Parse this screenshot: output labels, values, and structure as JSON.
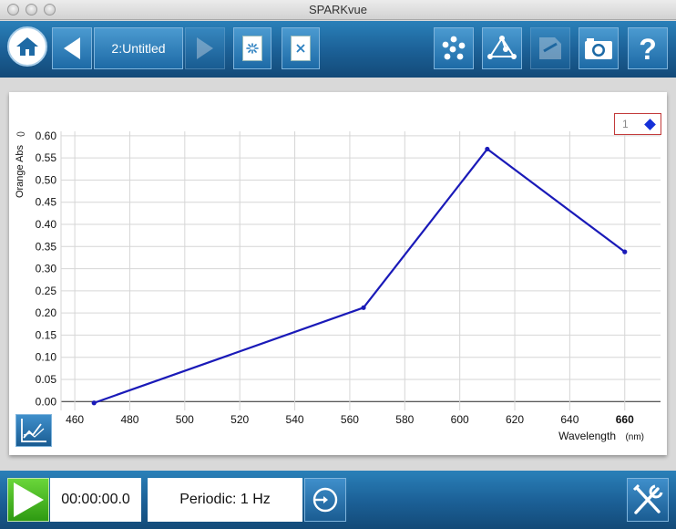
{
  "window": {
    "title": "SPARKvue"
  },
  "toolbar": {
    "document_title": "2:Untitled"
  },
  "legend": {
    "run_label": "1"
  },
  "chart_data": {
    "type": "line",
    "ylabel": "Orange Abs",
    "yunit": "()",
    "xlabel": "Wavelength",
    "xunit": "(nm)",
    "xlim": [
      455,
      673
    ],
    "ylim": [
      -0.02,
      0.61
    ],
    "xticks": [
      460,
      480,
      500,
      520,
      540,
      560,
      580,
      600,
      620,
      640,
      660
    ],
    "yticks": [
      0.0,
      0.05,
      0.1,
      0.15,
      0.2,
      0.25,
      0.3,
      0.35,
      0.4,
      0.45,
      0.5,
      0.55,
      0.6
    ],
    "ytick_labels": [
      "0.00",
      "0.05",
      "0.10",
      "0.15",
      "0.20",
      "0.25",
      "0.30",
      "0.35",
      "0.40",
      "0.45",
      "0.50",
      "0.55",
      "0.60"
    ],
    "grid": true,
    "legend_position": "top-right",
    "series": [
      {
        "name": "1",
        "color": "#1a1ab8",
        "x": [
          467,
          565,
          610,
          660
        ],
        "y": [
          -0.003,
          0.212,
          0.57,
          0.338
        ]
      }
    ]
  },
  "bottombar": {
    "elapsed_time": "00:00:00.0",
    "sample_rate": "Periodic: 1 Hz"
  },
  "colors": {
    "toolbar_blue": "#1b5f95",
    "series_line": "#1a1ab8",
    "play_green": "#3fae1c"
  }
}
